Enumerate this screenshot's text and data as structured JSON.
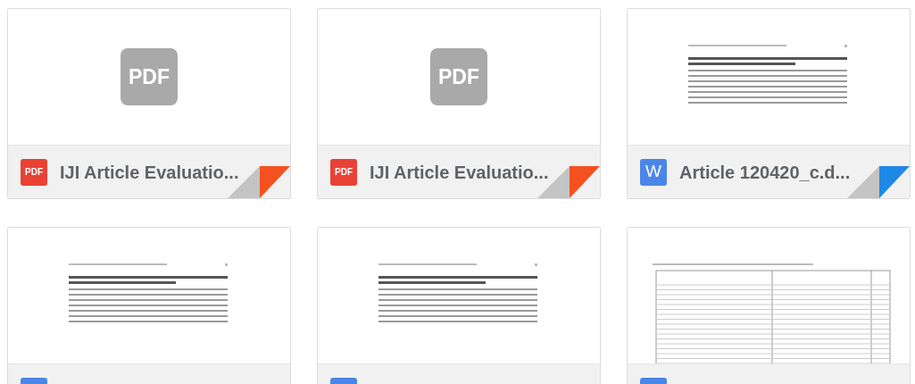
{
  "files": [
    {
      "kind": "pdf",
      "preview": {
        "kind": "placeholder",
        "label": "PDF"
      },
      "type_label": "PDF",
      "name": "IJI Article Evaluatio..."
    },
    {
      "kind": "pdf",
      "preview": {
        "kind": "placeholder",
        "label": "PDF"
      },
      "type_label": "PDF",
      "name": "IJI Article Evaluatio..."
    },
    {
      "kind": "word",
      "preview": {
        "kind": "article"
      },
      "type_label": "W",
      "name": "Article 120420_c.d..."
    },
    {
      "kind": "word",
      "preview": {
        "kind": "article"
      }
    },
    {
      "kind": "word",
      "preview": {
        "kind": "article"
      }
    },
    {
      "kind": "word",
      "preview": {
        "kind": "table"
      }
    }
  ]
}
